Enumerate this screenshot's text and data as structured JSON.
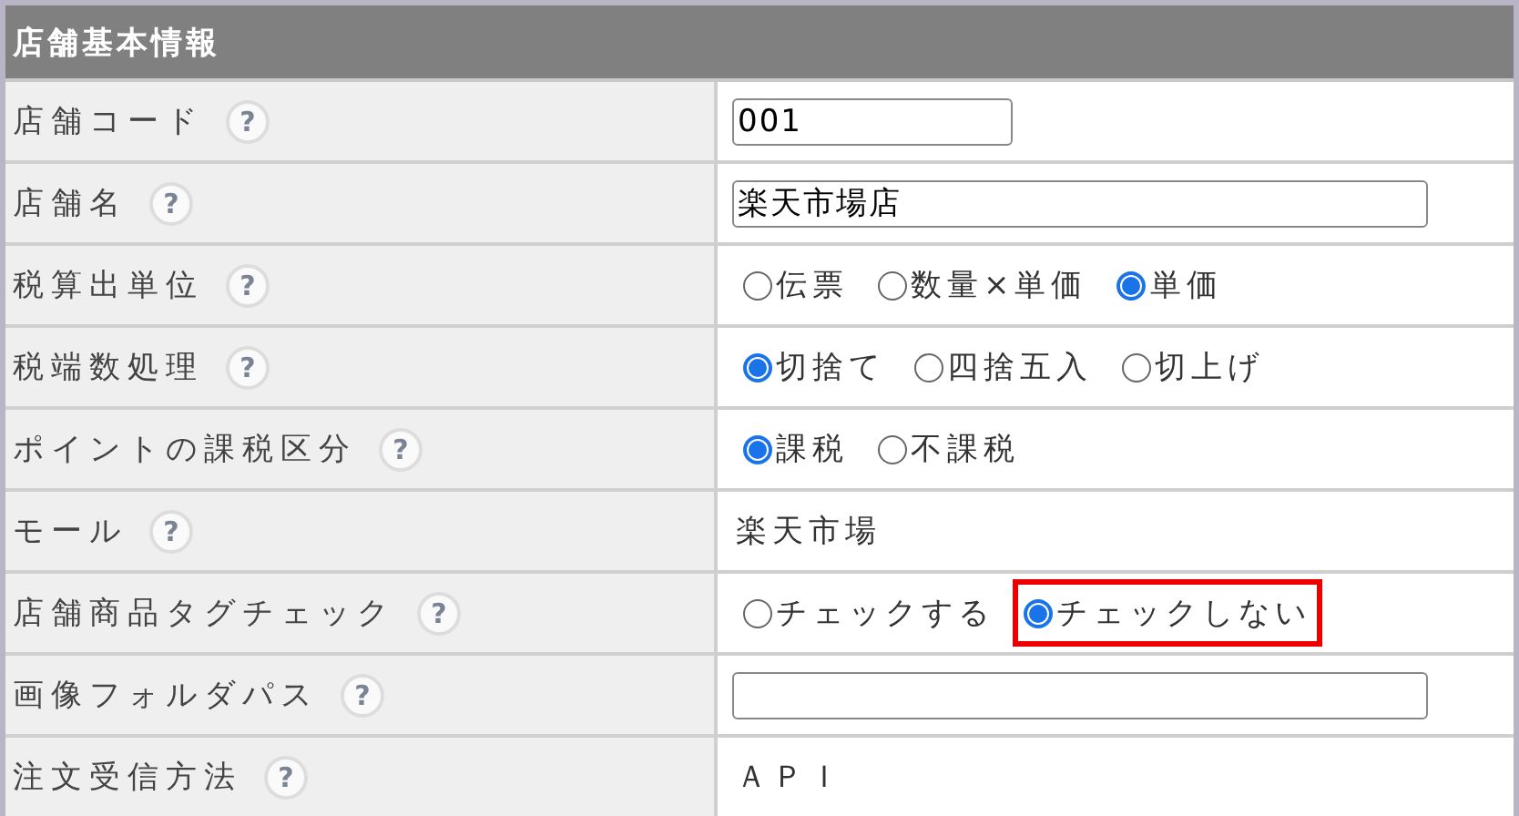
{
  "section_title": "店舗基本情報",
  "rows": [
    {
      "label": "店舗コード",
      "help": "?",
      "kind": "short-input",
      "value": "001"
    },
    {
      "label": "店舗名",
      "help": "?",
      "kind": "long-input",
      "value": "楽天市場店"
    },
    {
      "label": "税算出単位",
      "help": "?",
      "kind": "radio",
      "options": [
        {
          "label": "伝票",
          "selected": false,
          "highlighted": false
        },
        {
          "label": "数量×単価",
          "selected": false,
          "highlighted": false
        },
        {
          "label": "単価",
          "selected": true,
          "highlighted": false
        }
      ]
    },
    {
      "label": "税端数処理",
      "help": "?",
      "kind": "radio",
      "options": [
        {
          "label": "切捨て",
          "selected": true,
          "highlighted": false
        },
        {
          "label": "四捨五入",
          "selected": false,
          "highlighted": false
        },
        {
          "label": "切上げ",
          "selected": false,
          "highlighted": false
        }
      ]
    },
    {
      "label": "ポイントの課税区分",
      "help": "?",
      "kind": "radio",
      "options": [
        {
          "label": "課税",
          "selected": true,
          "highlighted": false
        },
        {
          "label": "不課税",
          "selected": false,
          "highlighted": false
        }
      ]
    },
    {
      "label": "モール",
      "help": "?",
      "kind": "text",
      "value": "楽天市場"
    },
    {
      "label": "店舗商品タグチェック",
      "help": "?",
      "kind": "radio",
      "options": [
        {
          "label": "チェックする",
          "selected": false,
          "highlighted": false
        },
        {
          "label": "チェックしない",
          "selected": true,
          "highlighted": true
        }
      ]
    },
    {
      "label": "画像フォルダパス",
      "help": "?",
      "kind": "long-input"
    },
    {
      "label": "注文受信方法",
      "help": "?",
      "kind": "text",
      "value": "ＡＰＩ"
    }
  ]
}
